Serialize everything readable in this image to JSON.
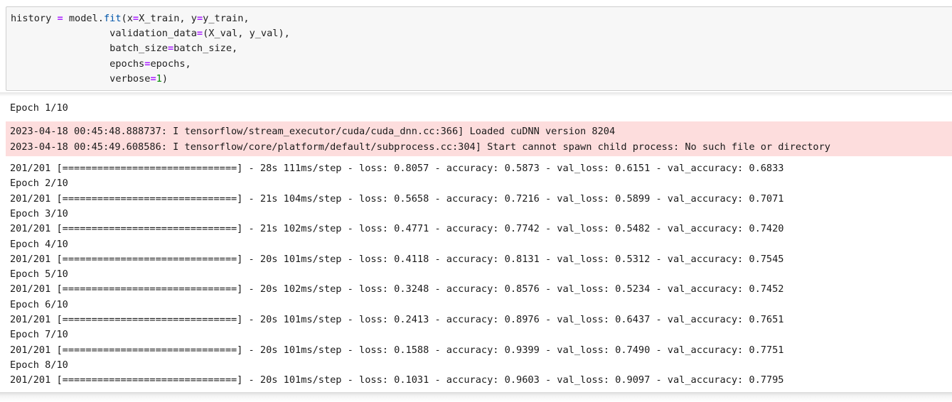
{
  "code_cell": {
    "line1": {
      "v1": "history",
      "op1": "=",
      "v2": "model.",
      "fn": "fit",
      "p1": "(",
      "k1": "x",
      "op2": "=",
      "v3": "X_train, ",
      "k2": "y",
      "op3": "=",
      "v4": "y_train,"
    },
    "line2": {
      "k": "validation_data",
      "op": "=",
      "v": "(X_val, y_val),"
    },
    "line3": {
      "k": "batch_size",
      "op": "=",
      "v": "batch_size,"
    },
    "line4": {
      "k": "epochs",
      "op": "=",
      "v": "epochs,"
    },
    "line5": {
      "k": "verbose",
      "op": "=",
      "num": "1",
      "v": ")"
    }
  },
  "output": {
    "epoch_1": "Epoch 1/10",
    "stderr": [
      "2023-04-18 00:45:48.888737: I tensorflow/stream_executor/cuda/cuda_dnn.cc:366] Loaded cuDNN version 8204",
      "2023-04-18 00:45:49.608586: I tensorflow/core/platform/default/subprocess.cc:304] Start cannot spawn child process: No such file or directory"
    ],
    "lines": [
      "201/201 [==============================] - 28s 111ms/step - loss: 0.8057 - accuracy: 0.5873 - val_loss: 0.6151 - val_accuracy: 0.6833",
      "Epoch 2/10",
      "201/201 [==============================] - 21s 104ms/step - loss: 0.5658 - accuracy: 0.7216 - val_loss: 0.5899 - val_accuracy: 0.7071",
      "Epoch 3/10",
      "201/201 [==============================] - 21s 102ms/step - loss: 0.4771 - accuracy: 0.7742 - val_loss: 0.5482 - val_accuracy: 0.7420",
      "Epoch 4/10",
      "201/201 [==============================] - 20s 101ms/step - loss: 0.4118 - accuracy: 0.8131 - val_loss: 0.5312 - val_accuracy: 0.7545",
      "Epoch 5/10",
      "201/201 [==============================] - 20s 102ms/step - loss: 0.3248 - accuracy: 0.8576 - val_loss: 0.5234 - val_accuracy: 0.7452",
      "Epoch 6/10",
      "201/201 [==============================] - 20s 101ms/step - loss: 0.2413 - accuracy: 0.8976 - val_loss: 0.6437 - val_accuracy: 0.7651",
      "Epoch 7/10",
      "201/201 [==============================] - 20s 101ms/step - loss: 0.1588 - accuracy: 0.9399 - val_loss: 0.7490 - val_accuracy: 0.7751",
      "Epoch 8/10",
      "201/201 [==============================] - 20s 101ms/step - loss: 0.1031 - accuracy: 0.9603 - val_loss: 0.9097 - val_accuracy: 0.7795"
    ]
  }
}
